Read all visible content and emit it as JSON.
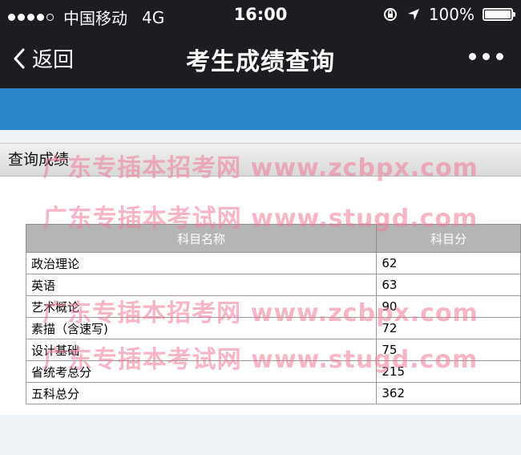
{
  "status_bar": {
    "carrier": "中国移动",
    "network": "4G",
    "time": "16:00",
    "battery": "100%"
  },
  "nav": {
    "back_label": "返回",
    "title": "考生成绩查询"
  },
  "panel": {
    "title": "查询成绩"
  },
  "table": {
    "headers": [
      "科目名称",
      "科目分"
    ],
    "rows": [
      {
        "name": "政治理论",
        "score": "62"
      },
      {
        "name": "英语",
        "score": "63"
      },
      {
        "name": "艺术概论",
        "score": "90"
      },
      {
        "name": "素描（含速写)",
        "score": "72"
      },
      {
        "name": "设计基础",
        "score": "75"
      },
      {
        "name": "省统考总分",
        "score": "215"
      },
      {
        "name": "五科总分",
        "score": "362"
      }
    ]
  },
  "watermarks": [
    "广东专插本招考网 www.zcbpx.com",
    "广东专插本考试网 www.stugd.com",
    "广东专插本招考网 www.zcbpx.com",
    "广东专插本考试网 www.stugd.com"
  ],
  "colors": {
    "bar": "#1c1c21",
    "banner": "#2c86c9",
    "watermark": "#f07896"
  }
}
